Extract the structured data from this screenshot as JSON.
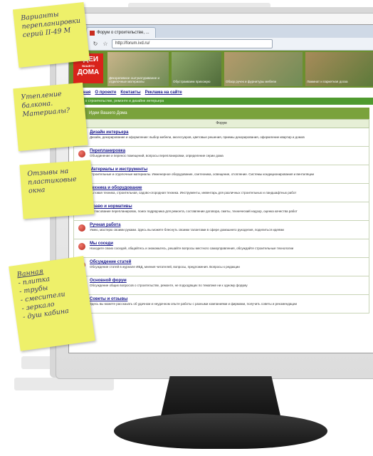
{
  "browser": {
    "tab_title": "Форум о строительстве, ...",
    "url": "http://forum.ivd.ru/"
  },
  "site": {
    "logo_line1": "ИДЕИ",
    "logo_line2": "ВАШЕГО",
    "logo_line3": "ДОМА",
    "banners": [
      "Декоративное оштукатуривание и отделочные материалы",
      "Обустраиваем прихожую",
      "Обзор ручек и фурнитуры мебели",
      "Ламинат и паркетная доска"
    ],
    "nav": [
      "Главная",
      "О проекте",
      "Контакты",
      "Реклама на сайте"
    ],
    "breadcrumb": "Форум о строительстве, ремонте и дизайне интерьера",
    "forum_title": "Идеи Вашего Дома",
    "column_header": "Форум"
  },
  "forums": [
    {
      "name": "Дизайн интерьера",
      "desc": "Дизайн, декорирование и оформление: выбор мебели, аксессуаров, цветовые решения, приемы декорирования, оформление квартир и домов"
    },
    {
      "name": "Перепланировка",
      "desc": "Объединение и перенос помещений, вопросы перепланировки, определение серии дома"
    },
    {
      "name": "Материалы и инструменты",
      "desc": "Строительные и отделочные материалы. Инженерное оборудование, сантехника, освещение, отопление. Системы кондиционирования и вентиляции"
    },
    {
      "name": "Техника и оборудование",
      "desc": "Бытовая техника, строительная, садово-огородная техника. Инструменты, инвентарь для различных строительных и ландшафтных работ"
    },
    {
      "name": "Право и нормативы",
      "desc": "Согласование перепланировок, поиск подрядчика для ремонта, составление договора, сметы, технический надзор, оценка качества работ"
    },
    {
      "name": "Ручная работа",
      "desc": "Умею, мастерю своими руками. Здесь вы можете блеснуть своими талантами в сфере домашнего рукоделия, поделиться идеями"
    },
    {
      "name": "Мы соседи",
      "desc": "Находите своих соседей, общайтесь и знакомьтесь, решайте вопросы местного самоуправления, обсуждайте строительные технологии"
    },
    {
      "name": "Обсуждение статей",
      "desc": "Обсуждение статей в журнале ИВД, мнения читателей, вопросы, предложения. Вопросы к редакции"
    },
    {
      "name": "Основной форум",
      "desc": "Обсуждение общих вопросов о строительстве, ремонте, не подходящих по тематике ни к одному форуму"
    },
    {
      "name": "Советы и отзывы",
      "desc": "Здесь вы можете рассказать об удачном и неудачном опыте работы с разными компаниями и фирмами, получить советы и рекомендации"
    }
  ],
  "notes": [
    {
      "lines": [
        "Варианты",
        "перепланировки",
        "серий II-49 М"
      ]
    },
    {
      "lines": [
        "Утепление",
        "балкона.",
        "Материалы?"
      ]
    },
    {
      "lines": [
        "Отзывы на",
        "пластиковые",
        "окна"
      ]
    },
    {
      "title": "Ванная",
      "lines": [
        "- плитка",
        "- трубы",
        "- смесители",
        "- зеркало",
        "- душ кабина"
      ]
    }
  ],
  "colors": {
    "site_green": "#6b8f2e",
    "logo_red": "#d9231b",
    "note_yellow": "#eef06a"
  }
}
